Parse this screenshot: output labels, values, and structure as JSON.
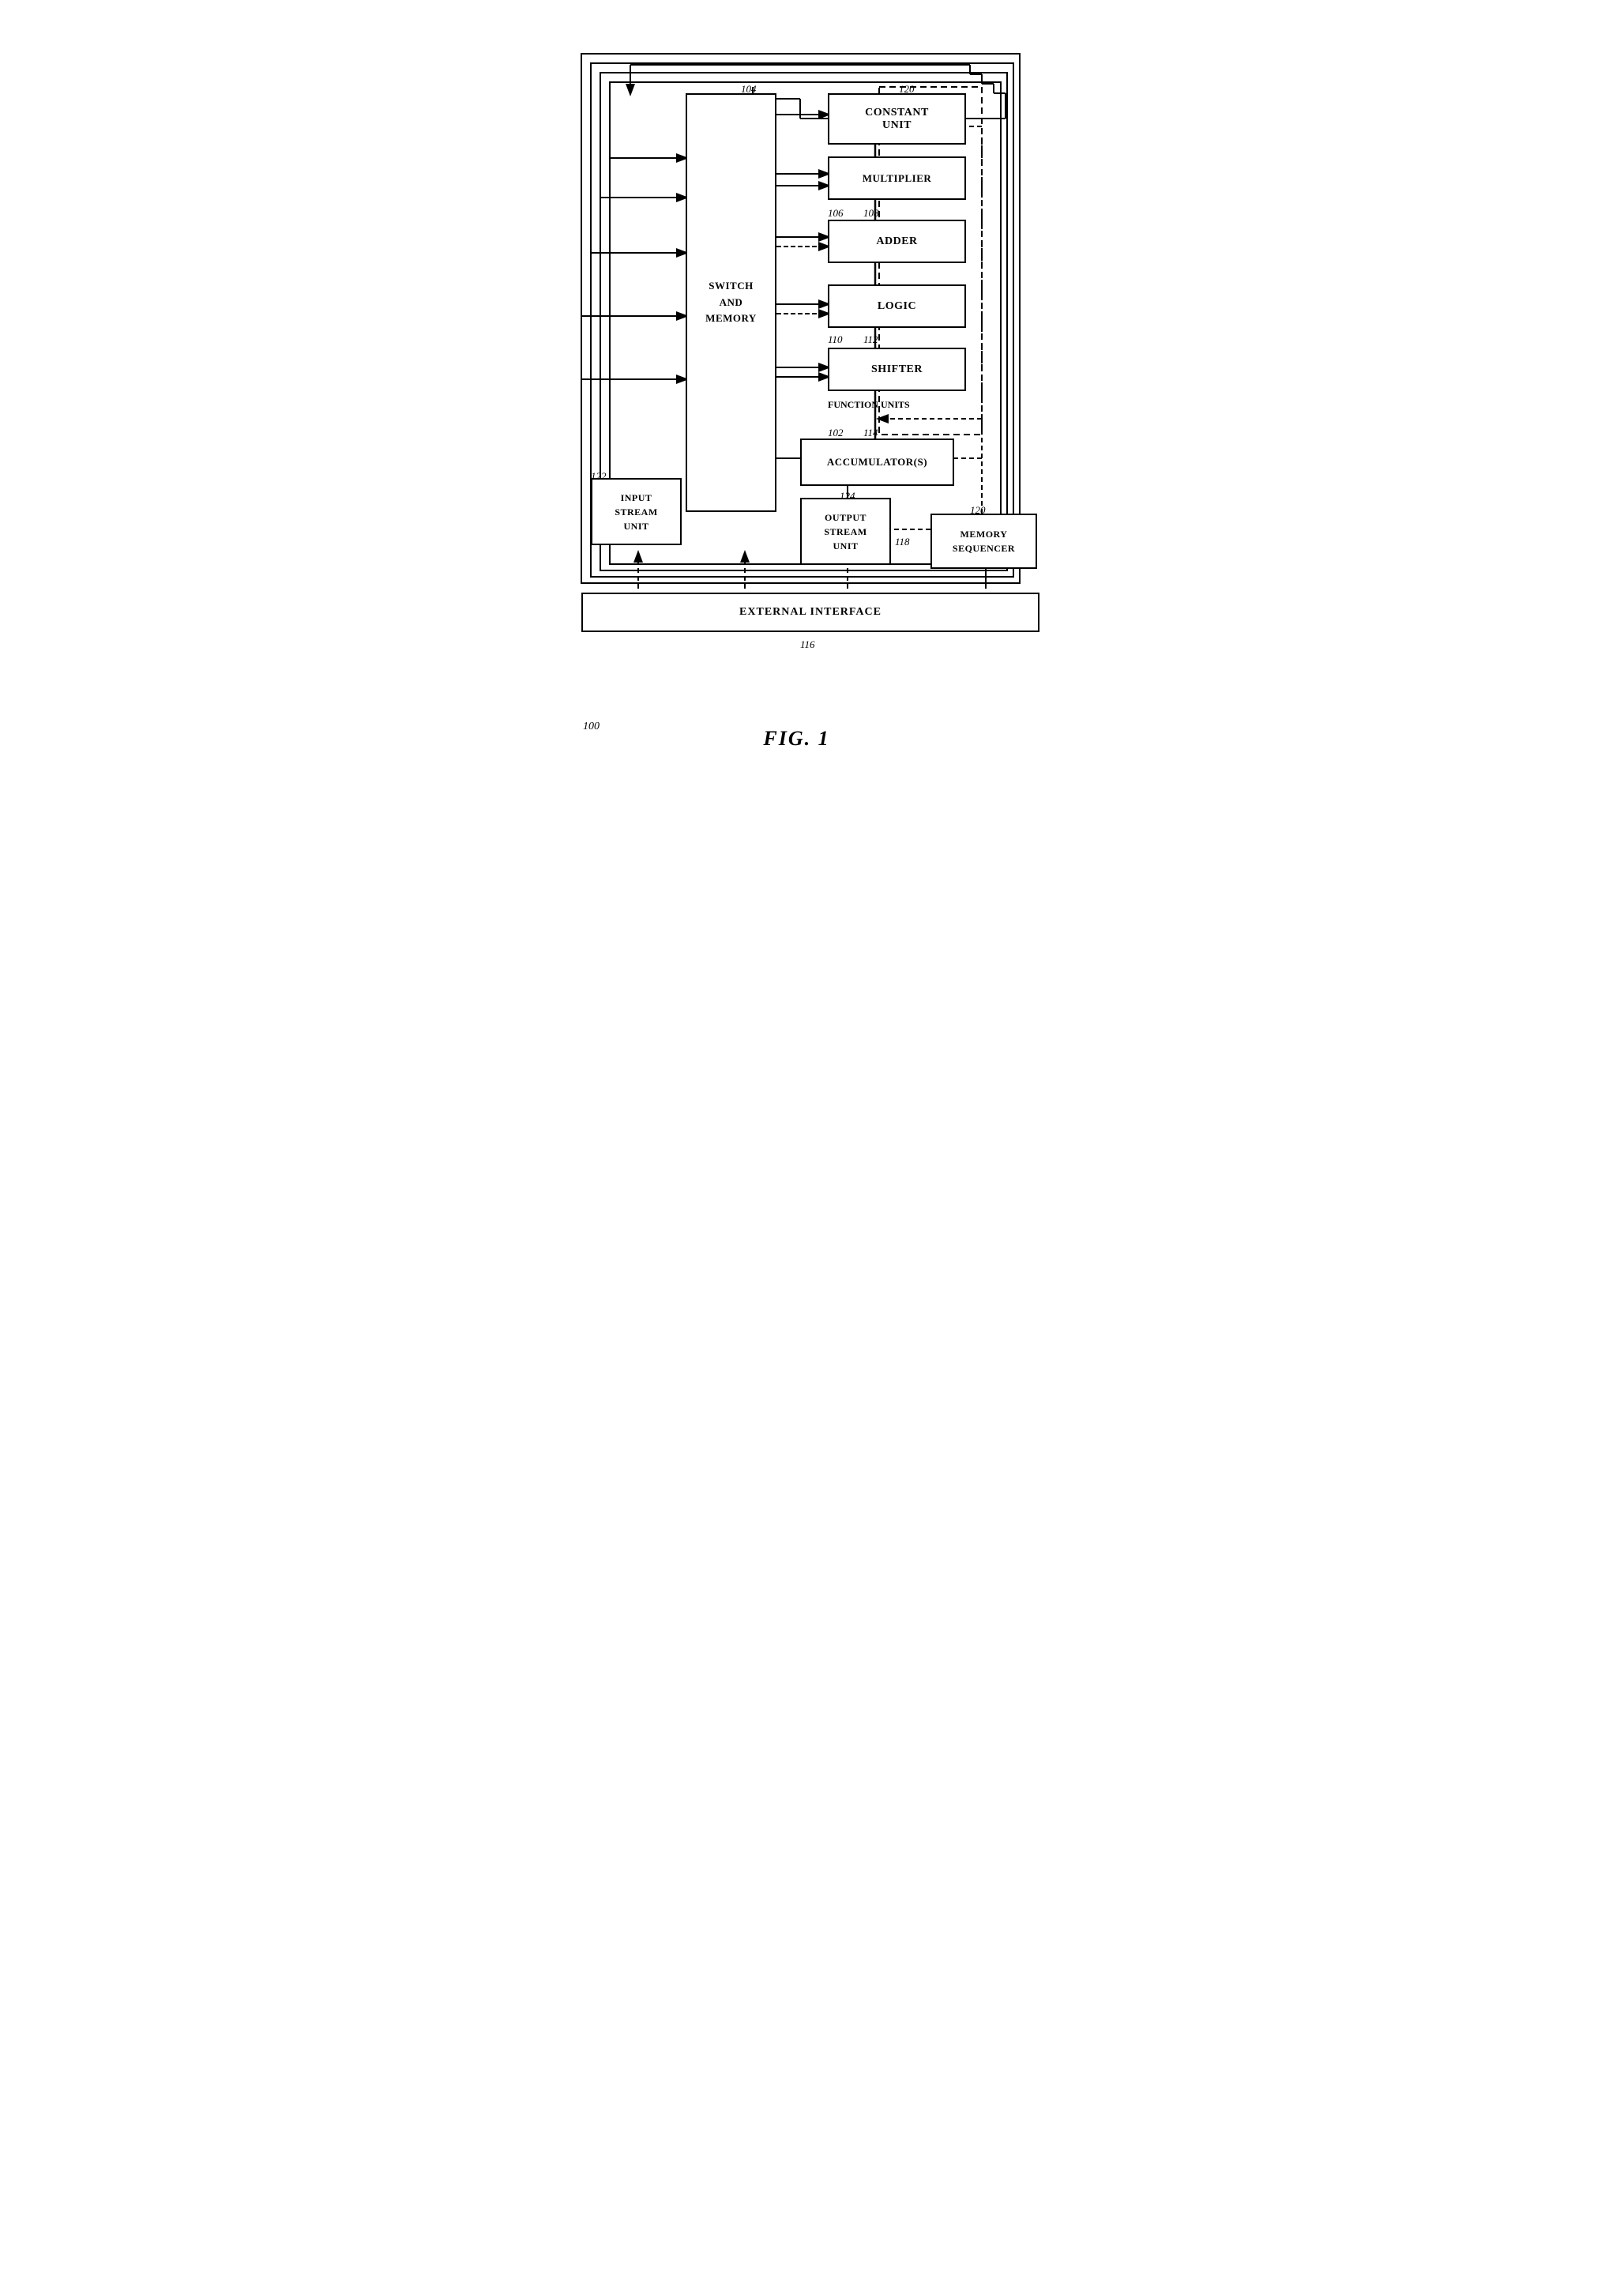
{
  "diagram": {
    "title": "FIG. 1",
    "figure_number": "100",
    "boxes": {
      "constant_unit": {
        "label": "CONSTANT\nUNIT",
        "ref": "120"
      },
      "multiplier": {
        "label": "MULTIPLIER",
        "ref": ""
      },
      "adder": {
        "label": "ADDER",
        "ref": ""
      },
      "logic": {
        "label": "LOGIC",
        "ref": ""
      },
      "shifter": {
        "label": "SHIFTER",
        "ref": ""
      },
      "function_units": {
        "label": "FUNCTION UNITS",
        "ref": ""
      },
      "accumulator": {
        "label": "ACCUMULATOR(S)",
        "ref": ""
      },
      "switch_memory": {
        "label": "SWITCH\nAND\nMEMORY",
        "ref": ""
      },
      "input_stream": {
        "label": "INPUT\nSTREAM\nUNIT",
        "ref": "122"
      },
      "output_stream": {
        "label": "OUTPUT\nSTREAM\nUNIT",
        "ref": "124"
      },
      "memory_sequencer": {
        "label": "MEMORY\nSEQUENCER",
        "ref": "120"
      },
      "external_interface": {
        "label": "EXTERNAL INTERFACE",
        "ref": "116"
      }
    },
    "labels": {
      "ref_104": "104",
      "ref_106": "106",
      "ref_108": "108",
      "ref_110": "110",
      "ref_112": "112",
      "ref_114": "114",
      "ref_102": "102",
      "ref_118": "118",
      "ref_100": "100"
    }
  }
}
